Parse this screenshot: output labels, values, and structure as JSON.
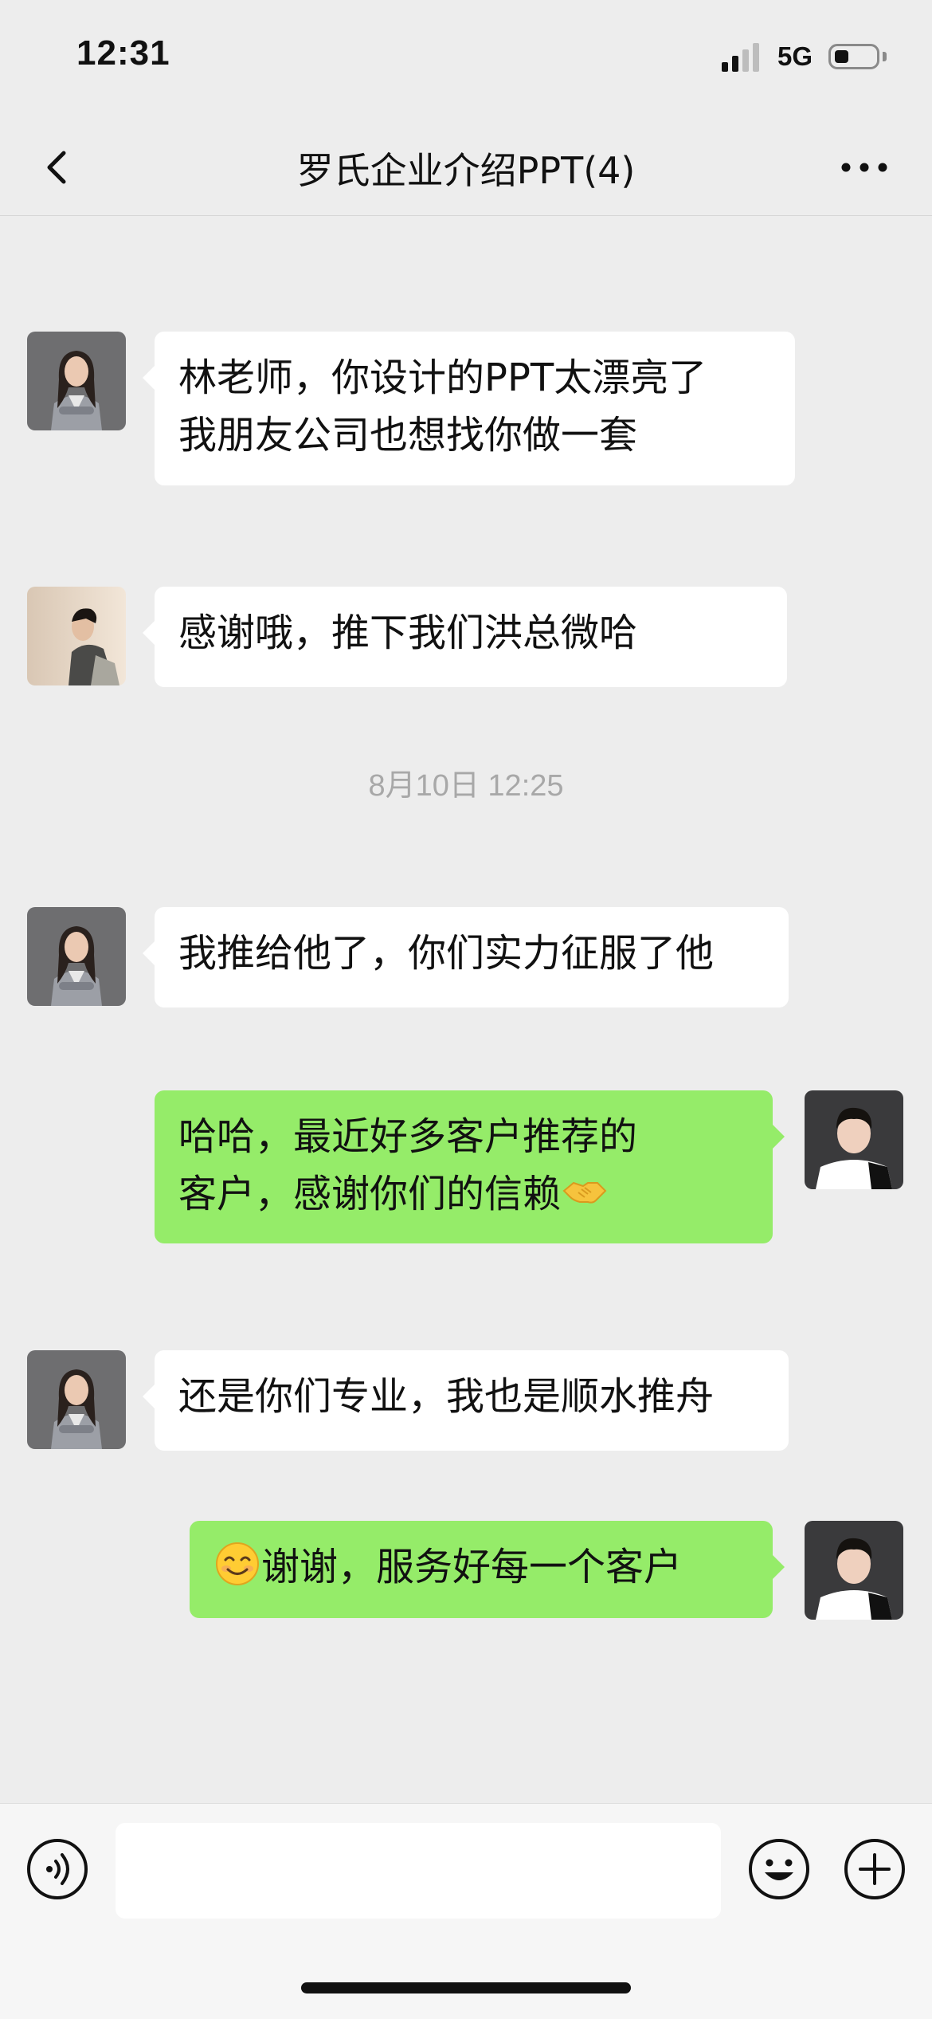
{
  "status_bar": {
    "time": "12:31",
    "network": "5G",
    "signal_bars_active": 2,
    "battery_level_fraction": 0.3
  },
  "nav": {
    "title": "罗氏企业介绍PPT(4)",
    "back_icon": "chevron-left-icon",
    "more_icon": "ellipsis-icon"
  },
  "timestamp": "8月10日 12:25",
  "messages": [
    {
      "side": "in",
      "avatar": "woman-gray-suit-avatar",
      "lines": [
        "林老师，你设计的PPT太漂亮了",
        "我朋友公司也想找你做一套"
      ]
    },
    {
      "side": "in",
      "avatar": "man-profile-avatar",
      "lines": [
        "感谢哦，推下我们洪总微哈"
      ]
    },
    {
      "side": "in",
      "avatar": "woman-gray-suit-avatar",
      "lines": [
        "我推给他了，你们实力征服了他"
      ]
    },
    {
      "side": "out",
      "avatar": "man-black-jacket-avatar",
      "lines": [
        "哈哈，最近好多客户推荐的",
        "客户，感谢你们的信赖"
      ],
      "trailing_emoji": "handshake-emoji"
    },
    {
      "side": "in",
      "avatar": "woman-gray-suit-avatar",
      "lines": [
        "还是你们专业，我也是顺水推舟"
      ]
    },
    {
      "side": "out",
      "avatar": "man-black-jacket-avatar",
      "leading_emoji": "smiling-face-emoji",
      "lines": [
        "谢谢，服务好每一个客户"
      ]
    }
  ],
  "input_bar": {
    "voice_icon": "voice-icon",
    "input_value": "",
    "emoji_icon": "smiley-icon",
    "plus_icon": "plus-circle-icon"
  },
  "colors": {
    "background": "#EDEDED",
    "incoming_bubble": "#FFFFFF",
    "outgoing_bubble": "#95EC69",
    "timestamp_text": "#A8A8A8"
  }
}
